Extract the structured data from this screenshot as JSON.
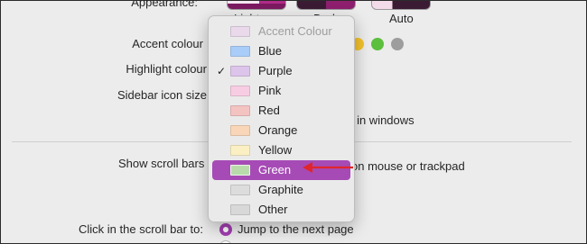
{
  "appearance": {
    "label": "Appearance:",
    "options": [
      {
        "label": "Light"
      },
      {
        "label": "Dark"
      },
      {
        "label": "Auto"
      }
    ]
  },
  "accent": {
    "label": "Accent colour",
    "visible_swatches": [
      "#f4c22b",
      "#5cbf3d",
      "#9d9d9d"
    ]
  },
  "highlight": {
    "label": "Highlight colour"
  },
  "sidebar_icon_size": {
    "label": "Sidebar icon size"
  },
  "tinting": {
    "suffix_text": "ng in windows"
  },
  "scroll_bars": {
    "label": "Show scroll bars",
    "suffix_text": "on mouse or trackpad"
  },
  "click_scroll": {
    "label": "Click in the scroll bar to:",
    "option1": "Jump to the next page"
  },
  "menu": {
    "items": [
      {
        "label": "Accent Colour",
        "color": "#e9d9ea",
        "disabled": true,
        "checked": false
      },
      {
        "label": "Blue",
        "color": "#a9cdf8",
        "disabled": false,
        "checked": false
      },
      {
        "label": "Purple",
        "color": "#dcc4ea",
        "disabled": false,
        "checked": true
      },
      {
        "label": "Pink",
        "color": "#f7cde3",
        "disabled": false,
        "checked": false
      },
      {
        "label": "Red",
        "color": "#f3c3c2",
        "disabled": false,
        "checked": false
      },
      {
        "label": "Orange",
        "color": "#f9d6b8",
        "disabled": false,
        "checked": false
      },
      {
        "label": "Yellow",
        "color": "#fbf0c3",
        "disabled": false,
        "checked": false
      },
      {
        "label": "Green",
        "color": "#b9dbac",
        "disabled": false,
        "checked": false,
        "hovered": true
      },
      {
        "label": "Graphite",
        "color": "#dcdcdc",
        "disabled": false,
        "checked": false
      },
      {
        "label": "Other",
        "color": "#d8d8d8",
        "disabled": false,
        "checked": false
      }
    ]
  },
  "colors": {
    "accent": "#a64bb5",
    "annotation_arrow": "#e0262c"
  }
}
